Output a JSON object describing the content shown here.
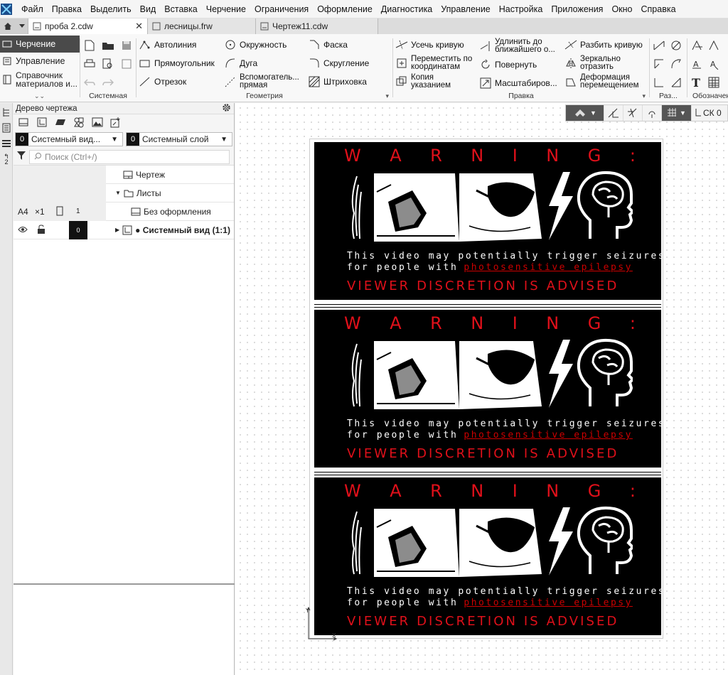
{
  "menu": [
    "Файл",
    "Правка",
    "Выделить",
    "Вид",
    "Вставка",
    "Черчение",
    "Ограничения",
    "Оформление",
    "Диагностика",
    "Управление",
    "Настройка",
    "Приложения",
    "Окно",
    "Справка"
  ],
  "tabs": [
    {
      "label": "проба 2.cdw",
      "active": true
    },
    {
      "label": "лесницы.frw",
      "active": false
    },
    {
      "label": "Чертеж11.cdw",
      "active": false
    }
  ],
  "ribbon": {
    "left_items": [
      {
        "label": "Черчение",
        "active": true
      },
      {
        "label": "Управление",
        "active": false
      },
      {
        "label": "Справочник материалов и...",
        "active": false
      }
    ],
    "groups": {
      "system": "Системная",
      "geometry": "Геометрия",
      "edit": "Правка",
      "size": "Раз...",
      "notation": "Обозначен"
    },
    "geometry_buttons": {
      "autoline": "Автолиния",
      "rectangle": "Прямоугольник",
      "segment": "Отрезок",
      "circle": "Окружность",
      "arc": "Дуга",
      "auxiliary_line1": "Вспомогатель...",
      "auxiliary_line2": "прямая",
      "chamfer": "Фаска",
      "fillet": "Скругление",
      "hatch": "Штриховка"
    },
    "edit_buttons": {
      "trim_curve": "Усечь кривую",
      "move_coords1": "Переместить по",
      "move_coords2": "координатам",
      "copy1": "Копия",
      "copy2": "указанием",
      "extend1": "Удлинить до",
      "extend2": "ближайшего о...",
      "rotate": "Повернуть",
      "scale": "Масштабиров...",
      "split_curve": "Разбить кривую",
      "mirror1": "Зеркально",
      "mirror2": "отразить",
      "deform1": "Деформация",
      "deform2": "перемещением"
    }
  },
  "tree_panel": {
    "title": "Дерево чертежа",
    "view_select": {
      "num": "0",
      "label": "Системный вид..."
    },
    "layer_select": {
      "num": "0",
      "label": "Системный слой"
    },
    "search_placeholder": "Поиск (Ctrl+/)",
    "rows": {
      "drawing": "Чертеж",
      "sheets": "Листы",
      "format": "A4",
      "multiplier": "×1",
      "sheet_count": "1",
      "no_frame": "Без оформления",
      "layer_num": "0",
      "system_view": "● Системный вид (1:1)"
    }
  },
  "vstrip": {
    "label": "2"
  },
  "canvas_toolbar": {
    "cs_label": "СК 0"
  },
  "warning_panels": [
    {
      "title_letters": [
        "W",
        "A",
        "R",
        "N",
        "I",
        "N",
        "G",
        ":"
      ],
      "line1": "This video may potentially trigger seizures",
      "line2_prefix": "for people with",
      "line2_link": "photosensitive epilepsy",
      "footer": "VIEWER DISCRETION IS ADVISED"
    },
    {
      "title_letters": [
        "W",
        "A",
        "R",
        "N",
        "I",
        "N",
        "G",
        ":"
      ],
      "line1": "This video may potentially trigger seizures",
      "line2_prefix": "for people with",
      "line2_link": "photosensitive epilepsy",
      "footer": "VIEWER DISCRETION IS ADVISED"
    },
    {
      "title_letters": [
        "W",
        "A",
        "R",
        "N",
        "I",
        "N",
        "G",
        ":"
      ],
      "line1": "This video may potentially trigger seizures",
      "line2_prefix": "for people with",
      "line2_link": "photosensitive epilepsy",
      "footer": "VIEWER DISCRETION IS ADVISED"
    }
  ],
  "colors": {
    "warning_red": "#e0101a",
    "link_red": "#c00000",
    "panel_black": "#000000"
  }
}
